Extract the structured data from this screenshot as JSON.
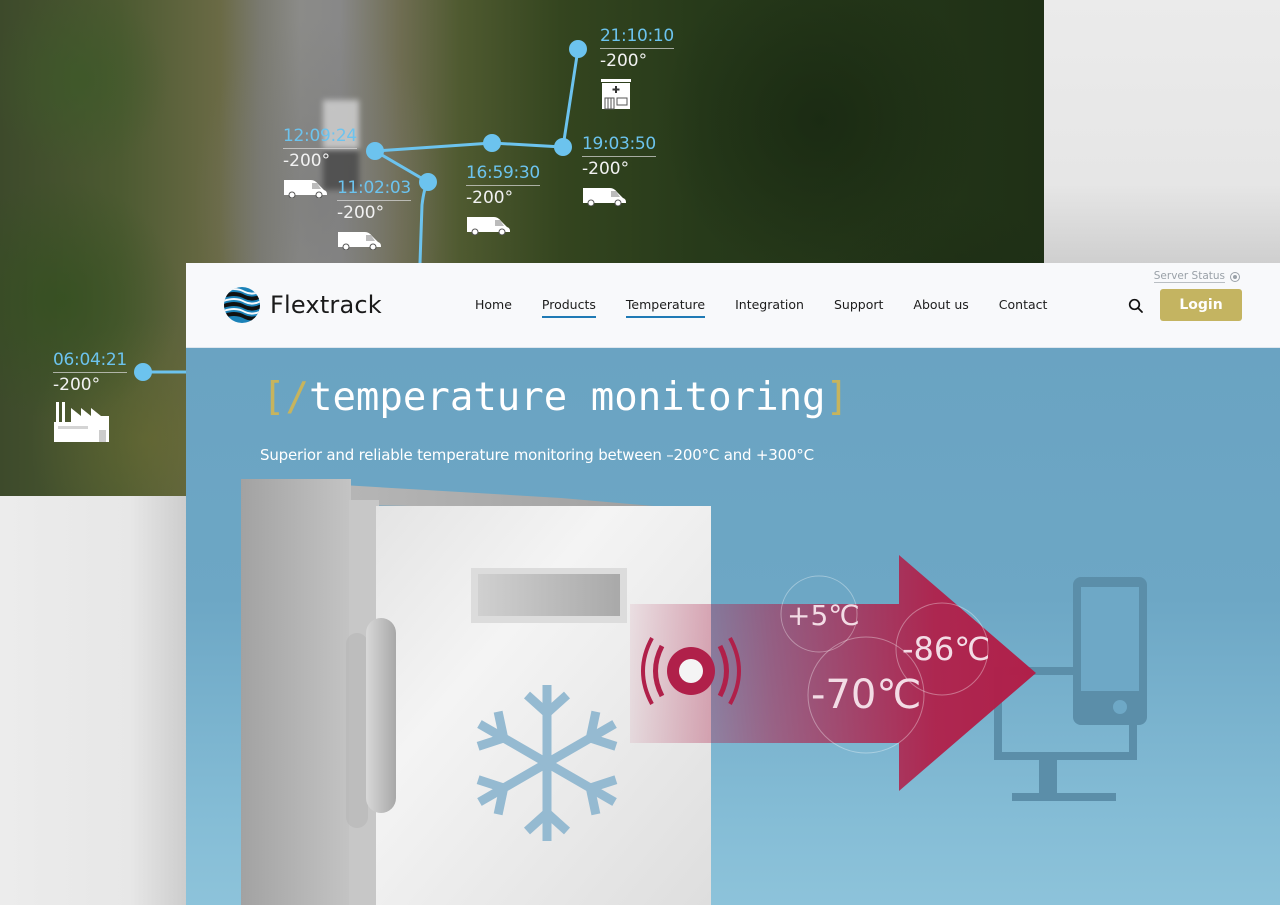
{
  "background": {
    "tracking_points": [
      {
        "time": "06:04:21",
        "temperature": "-200°",
        "icon": "factory-icon"
      },
      {
        "time": "11:02:03",
        "temperature": "-200°",
        "icon": "van-icon"
      },
      {
        "time": "12:09:24",
        "temperature": "-200°",
        "icon": "van-icon"
      },
      {
        "time": "16:59:30",
        "temperature": "-200°",
        "icon": "van-icon"
      },
      {
        "time": "19:03:50",
        "temperature": "-200°",
        "icon": "van-icon"
      },
      {
        "time": "21:10:10",
        "temperature": "-200°",
        "icon": "pharmacy-icon"
      }
    ],
    "route_color": "#6cc3ee"
  },
  "header": {
    "brand": "Flextrack",
    "nav": [
      {
        "label": "Home",
        "active": false
      },
      {
        "label": "Products",
        "active": true
      },
      {
        "label": "Temperature",
        "active": true
      },
      {
        "label": "Integration",
        "active": false
      },
      {
        "label": "Support",
        "active": false
      },
      {
        "label": "About us",
        "active": false
      },
      {
        "label": "Contact",
        "active": false
      }
    ],
    "server_status_label": "Server Status",
    "search_icon": "search-icon",
    "login_label": "Login",
    "accent_color": "#1f7ab5",
    "login_color": "#c4b461"
  },
  "hero": {
    "title_open": "[",
    "title_slash": "/",
    "title_text": "temperature monitoring",
    "title_close": "]",
    "subtitle": "Superior and reliable temperature monitoring between –200°C and +300°C",
    "illustration": {
      "temperatures": [
        "+5℃",
        "-70℃",
        "-86℃"
      ],
      "icons": [
        "freezer",
        "snowflake-icon",
        "sensor-signal-icon",
        "arrow",
        "monitor-icon",
        "smartphone-icon"
      ],
      "arrow_color": "#b0204a"
    }
  }
}
